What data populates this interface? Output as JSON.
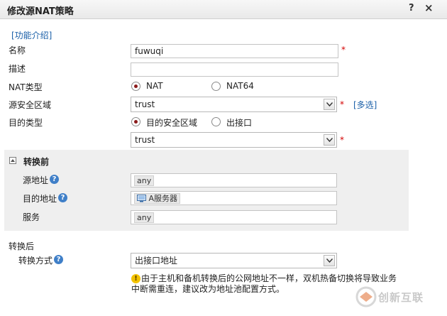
{
  "dialog": {
    "title": "修改源NAT策略",
    "help_label": "?",
    "close_label": "×"
  },
  "intro_link": "[功能介绍]",
  "form": {
    "name_label": "名称",
    "name_value": "fuwuqi",
    "desc_label": "描述",
    "desc_value": "",
    "nat_type_label": "NAT类型",
    "nat_type_options": [
      "NAT",
      "NAT64"
    ],
    "nat_type_selected": "NAT",
    "src_zone_label": "源安全区域",
    "src_zone_value": "trust",
    "multi_select_link": "[多选]",
    "dst_type_label": "目的类型",
    "dst_type_options": [
      "目的安全区域",
      "出接口"
    ],
    "dst_type_selected": "目的安全区域",
    "dst_zone_value": "trust",
    "required_mark": "*"
  },
  "before": {
    "header": "转换前",
    "src_addr_label": "源地址",
    "src_addr_value": "any",
    "dst_addr_label": "目的地址",
    "dst_addr_value": "A服务器",
    "service_label": "服务",
    "service_value": "any"
  },
  "after": {
    "header": "转换后",
    "method_label": "转换方式",
    "method_value": "出接口地址",
    "warning": "由于主机和备机转换后的公网地址不一样，双机热备切换将导致业务中断需重连，建议改为地址池配置方式。"
  },
  "watermark": {
    "text": "创新互联"
  },
  "colors": {
    "link": "#1a5fa8",
    "required": "#d40000",
    "radio_selected": "#8b1a1a",
    "help_icon": "#3f7fc8",
    "section_bg": "#efefef",
    "warning_icon": "#f2c200"
  },
  "icons": {
    "help": "question-circle-icon",
    "warning": "warning-icon",
    "dropdown": "chevron-down-icon",
    "server": "server-icon",
    "collapse": "collapse-icon",
    "close": "close-icon"
  }
}
